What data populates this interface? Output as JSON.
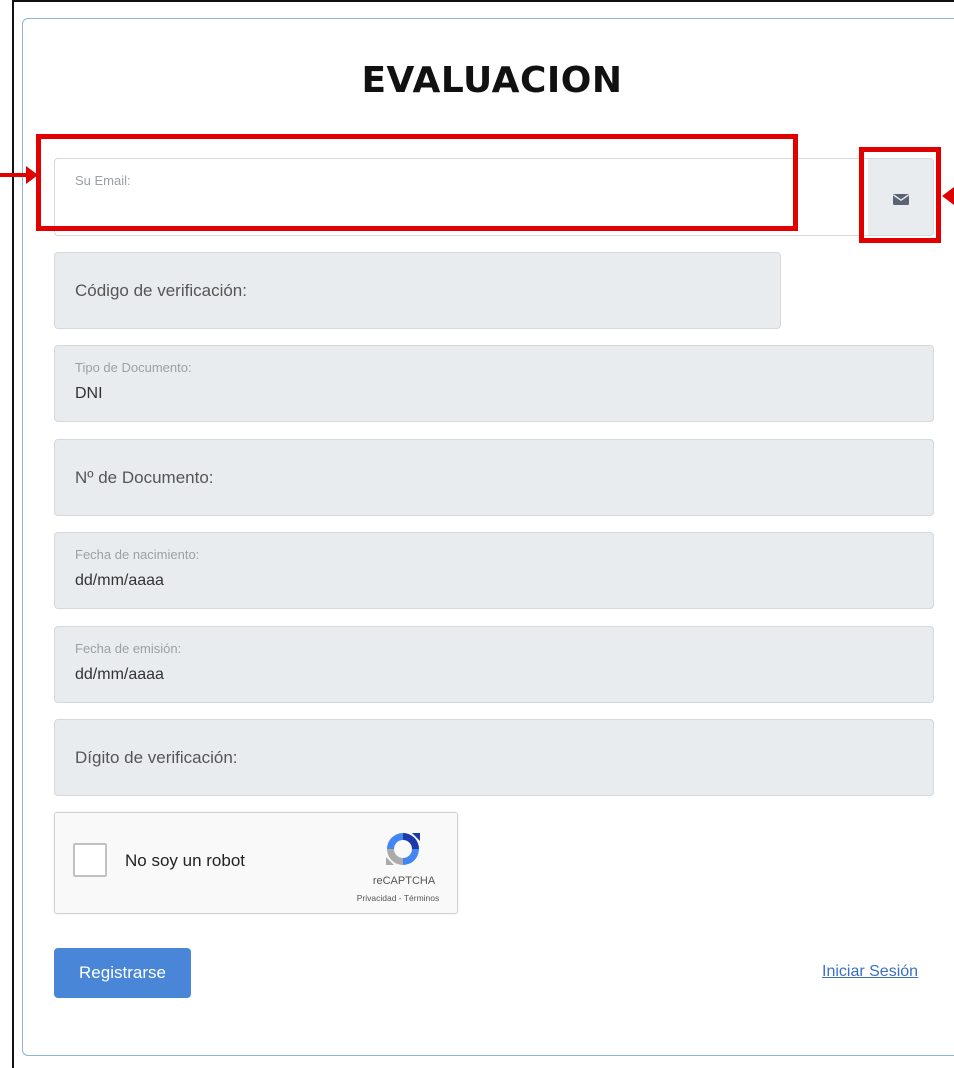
{
  "form": {
    "title": "EVALUACION",
    "email": {
      "label": "Su Email:",
      "value": "",
      "icon": "envelope-icon"
    },
    "verification_code": {
      "placeholder": "Código de verificación:"
    },
    "document_type": {
      "label": "Tipo de Documento:",
      "value": "DNI"
    },
    "document_number": {
      "placeholder": "Nº de Documento:"
    },
    "birth_date": {
      "label": "Fecha de nacimiento:",
      "value": "dd/mm/aaaa"
    },
    "issue_date": {
      "label": "Fecha de emisión:",
      "value": "dd/mm/aaaa"
    },
    "check_digit": {
      "placeholder": "Dígito de verificación:"
    },
    "recaptcha": {
      "label": "No soy un robot",
      "brand": "reCAPTCHA",
      "terms": "Privacidad - Términos"
    },
    "register_button": "Registrarse",
    "login_link": "Iniciar Sesión"
  },
  "colors": {
    "highlight": "#e00000",
    "field_bg": "#e9ecef",
    "button_bg": "#4a86d8",
    "link": "#3a6fc4"
  }
}
